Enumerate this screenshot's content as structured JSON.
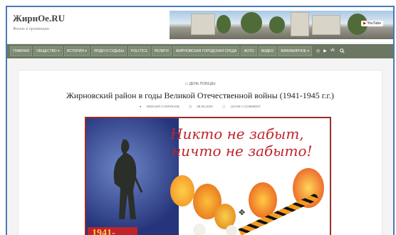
{
  "site": {
    "logo": "ЖирнОе.RU",
    "tagline": "Жизнь в провинции"
  },
  "banner": {
    "youtube_label": "YouTube"
  },
  "nav": {
    "items": [
      "ГЛАВНАЯ",
      "ОБЩЕСТВО ▾",
      "ИСТОРИЯ ▾",
      "ЛЮДИ И СУДЬБЫ",
      "POLITICS",
      "РЕЛИГИ",
      "ЖИРНОВСКАЯ ГОРОДСКАЯ СРЕДА",
      "ФОТО",
      "ВИДЕО",
      "ВИКИЖИРНОЕ ▾"
    ],
    "social_icons": [
      "instagram-icon",
      "youtube-icon",
      "vk-icon"
    ]
  },
  "article": {
    "category": "ДЕНЬ ПОБЕДЫ",
    "title": "Жирновский район в годы Великой Отечественной войны (1941-1945 г.г.)",
    "author": "МИХАИЛ САФРОНОВ",
    "date": "08.05.2020",
    "comment_link": "LEAVE A COMMENT"
  },
  "poster": {
    "slogan_line1": "Никто не забыт,",
    "slogan_line2": "ничто не забыто!",
    "year": "1941-"
  }
}
